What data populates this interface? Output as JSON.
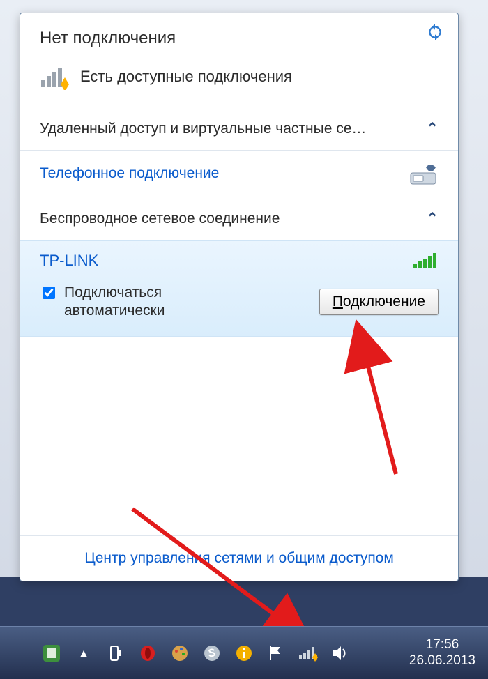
{
  "panel": {
    "title": "Нет подключения",
    "available": "Есть доступные подключения",
    "section_vpn": "Удаленный доступ и виртуальные частные се…",
    "dial_label": "Телефонное подключение",
    "section_wifi": "Беспроводное сетевое соединение",
    "ssid": "TP-LINK",
    "auto_connect": "Подключаться автоматически",
    "connect_btn_letter": "П",
    "connect_btn_rest": "одключение",
    "footer_link": "Центр управления сетями и общим доступом"
  },
  "taskbar": {
    "time": "17:56",
    "date": "26.06.2013"
  }
}
